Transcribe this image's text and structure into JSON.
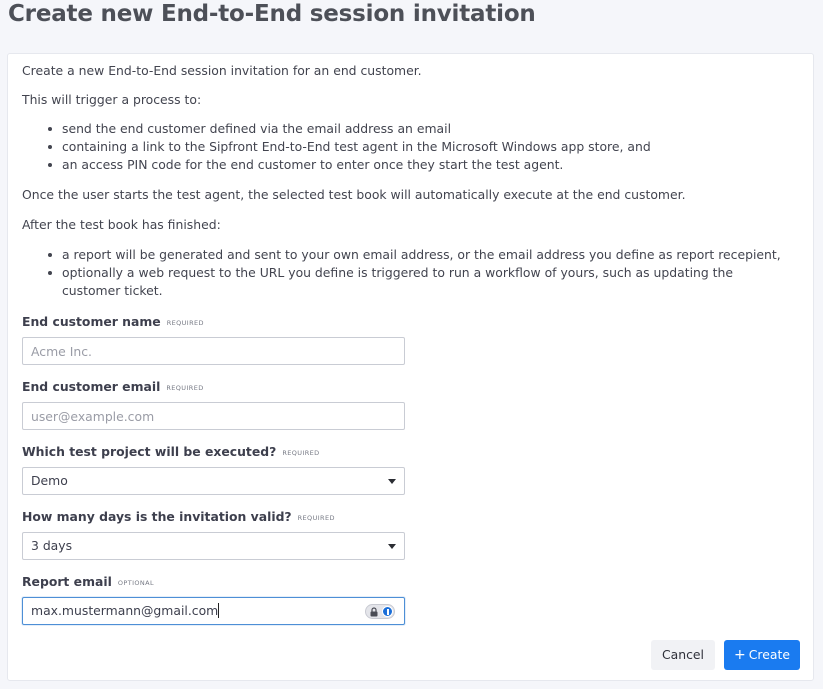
{
  "page": {
    "title": "Create new End-to-End session invitation"
  },
  "intro": {
    "line1": "Create a new End-to-End session invitation for an end customer.",
    "line2": "This will trigger a process to:",
    "process_steps": [
      "send the end customer defined via the email address an email",
      "containing a link to the Sipfront End-to-End test agent in the Microsoft Windows app store, and",
      "an access PIN code for the end customer to enter once they start the test agent."
    ],
    "line3": "Once the user starts the test agent, the selected test book will automatically execute at the end customer.",
    "line4": "After the test book has finished:",
    "after_steps": [
      "a report will be generated and sent to your own email address, or the email address you define as report recepient,",
      "optionally a web request to the URL you define is triggered to run a workflow of yours, such as updating the customer ticket."
    ]
  },
  "form": {
    "customer_name": {
      "label": "End customer name",
      "tag": "REQUIRED",
      "placeholder": "Acme Inc.",
      "value": ""
    },
    "customer_email": {
      "label": "End customer email",
      "tag": "REQUIRED",
      "placeholder": "user@example.com",
      "value": ""
    },
    "test_project": {
      "label": "Which test project will be executed?",
      "tag": "REQUIRED",
      "selected": "Demo"
    },
    "valid_days": {
      "label": "How many days is the invitation valid?",
      "tag": "REQUIRED",
      "selected": "3 days"
    },
    "report_email": {
      "label": "Report email",
      "tag": "OPTIONAL",
      "value": "max.mustermann@gmail.com"
    }
  },
  "actions": {
    "cancel_label": "Cancel",
    "create_label": "Create",
    "create_icon": "plus-icon"
  },
  "colors": {
    "primary": "#1a7bf0",
    "focus_border": "#4d8fd6",
    "page_bg": "#f5f6fa"
  }
}
